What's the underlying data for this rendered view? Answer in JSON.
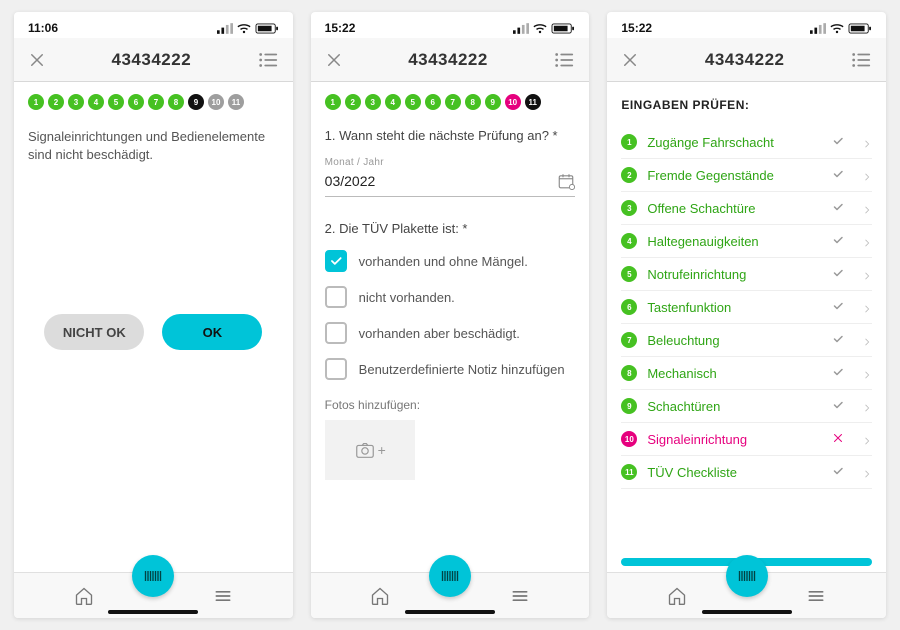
{
  "screens": {
    "s1": {
      "time": "11:06",
      "title": "43434222",
      "dots": [
        {
          "n": "1",
          "c": "green"
        },
        {
          "n": "2",
          "c": "green"
        },
        {
          "n": "3",
          "c": "green"
        },
        {
          "n": "4",
          "c": "green"
        },
        {
          "n": "5",
          "c": "green"
        },
        {
          "n": "6",
          "c": "green"
        },
        {
          "n": "7",
          "c": "green"
        },
        {
          "n": "8",
          "c": "green"
        },
        {
          "n": "9",
          "c": "black"
        },
        {
          "n": "10",
          "c": "gray"
        },
        {
          "n": "11",
          "c": "gray"
        }
      ],
      "question": "Signaleinrichtungen und Bedienelemente sind nicht beschädigt.",
      "btn_no": "NICHT OK",
      "btn_yes": "OK"
    },
    "s2": {
      "time": "15:22",
      "title": "43434222",
      "dots": [
        {
          "n": "1",
          "c": "green"
        },
        {
          "n": "2",
          "c": "green"
        },
        {
          "n": "3",
          "c": "green"
        },
        {
          "n": "4",
          "c": "green"
        },
        {
          "n": "5",
          "c": "green"
        },
        {
          "n": "6",
          "c": "green"
        },
        {
          "n": "7",
          "c": "green"
        },
        {
          "n": "8",
          "c": "green"
        },
        {
          "n": "9",
          "c": "green"
        },
        {
          "n": "10",
          "c": "red"
        },
        {
          "n": "11",
          "c": "black"
        }
      ],
      "q1": "1. Wann steht die nächste Prüfung an? *",
      "date_label": "Monat / Jahr",
      "date_value": "03/2022",
      "q2": "2. Die TÜV Plakette ist: *",
      "opts": [
        {
          "label": "vorhanden und ohne Mängel.",
          "checked": true
        },
        {
          "label": "nicht vorhanden.",
          "checked": false
        },
        {
          "label": "vorhanden aber beschädigt.",
          "checked": false
        },
        {
          "label": "Benutzerdefinierte Notiz hinzufügen",
          "checked": false
        }
      ],
      "photos": "Fotos hinzufügen:"
    },
    "s3": {
      "time": "15:22",
      "title": "43434222",
      "heading": "EINGABEN PRÜFEN:",
      "rows": [
        {
          "n": "1",
          "label": "Zugänge Fahrschacht",
          "color": "green",
          "status": "check"
        },
        {
          "n": "2",
          "label": "Fremde Gegenstände",
          "color": "green",
          "status": "check"
        },
        {
          "n": "3",
          "label": "Offene Schachtüre",
          "color": "green",
          "status": "check"
        },
        {
          "n": "4",
          "label": "Haltegenauigkeiten",
          "color": "green",
          "status": "check"
        },
        {
          "n": "5",
          "label": "Notrufeinrichtung",
          "color": "green",
          "status": "check"
        },
        {
          "n": "6",
          "label": "Tastenfunktion",
          "color": "green",
          "status": "check"
        },
        {
          "n": "7",
          "label": "Beleuchtung",
          "color": "green",
          "status": "check"
        },
        {
          "n": "8",
          "label": "Mechanisch",
          "color": "green",
          "status": "check"
        },
        {
          "n": "9",
          "label": "Schachtüren",
          "color": "green",
          "status": "check"
        },
        {
          "n": "10",
          "label": "Signaleinrichtung",
          "color": "red",
          "status": "x"
        },
        {
          "n": "11",
          "label": "TÜV Checkliste",
          "color": "green",
          "status": "check"
        }
      ]
    }
  }
}
